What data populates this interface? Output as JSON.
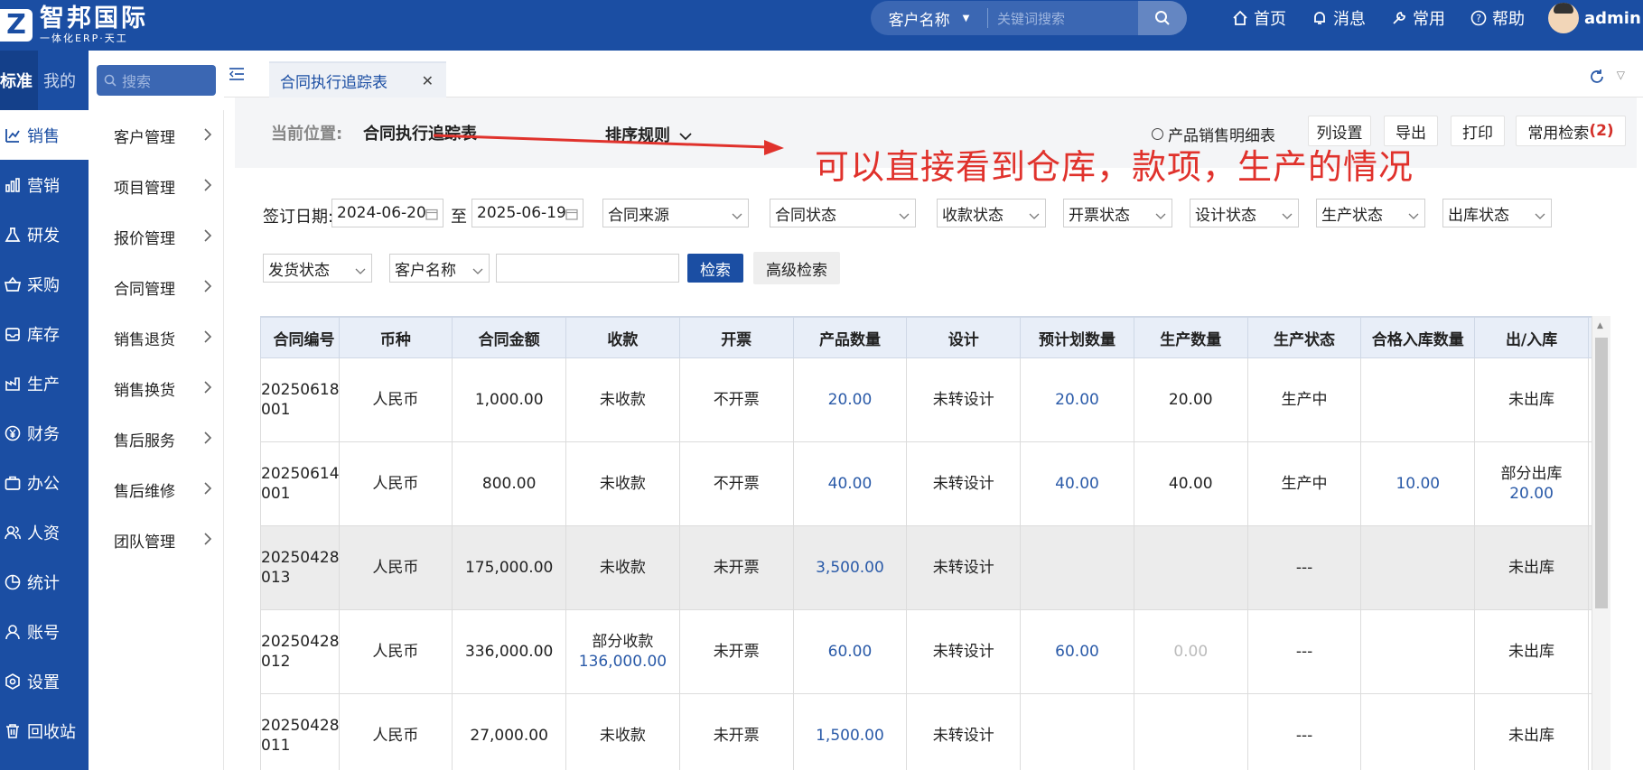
{
  "header": {
    "logo_letter": "Z",
    "brand": "智邦国际",
    "slogan": "一体化ERP·天工",
    "search_type": "客户名称",
    "search_placeholder": "关键词搜索",
    "nav": [
      {
        "label": "首页",
        "icon": "home-icon"
      },
      {
        "label": "消息",
        "icon": "bell-icon"
      },
      {
        "label": "常用",
        "icon": "wrench-icon"
      },
      {
        "label": "帮助",
        "icon": "help-icon"
      }
    ],
    "user": "admin"
  },
  "sidebar": {
    "tabs": [
      "标准",
      "我的"
    ],
    "search_placeholder": "搜索",
    "items": [
      {
        "label": "销售",
        "icon": "chart-icon",
        "active": true
      },
      {
        "label": "营销",
        "icon": "bar-chart-icon"
      },
      {
        "label": "研发",
        "icon": "flask-icon"
      },
      {
        "label": "采购",
        "icon": "basket-icon"
      },
      {
        "label": "库存",
        "icon": "inbox-icon"
      },
      {
        "label": "生产",
        "icon": "factory-icon"
      },
      {
        "label": "财务",
        "icon": "yen-icon"
      },
      {
        "label": "办公",
        "icon": "briefcase-icon"
      },
      {
        "label": "人资",
        "icon": "users-icon"
      },
      {
        "label": "统计",
        "icon": "pie-icon"
      },
      {
        "label": "账号",
        "icon": "user-icon"
      },
      {
        "label": "设置",
        "icon": "gear-icon"
      },
      {
        "label": "回收站",
        "icon": "trash-icon"
      }
    ]
  },
  "submenu": {
    "items": [
      "客户管理",
      "项目管理",
      "报价管理",
      "合同管理",
      "销售退货",
      "销售换货",
      "售后服务",
      "售后维修",
      "团队管理"
    ]
  },
  "tabbar": {
    "active_tab": "合同执行追踪表"
  },
  "crumb": {
    "label": "当前位置:",
    "value": "合同执行追踪表",
    "sort_rule": "排序规则",
    "radio_option": "产品销售明细表",
    "buttons": {
      "columns": "列设置",
      "export": "导出",
      "print": "打印",
      "saved_search": "常用检索",
      "saved_search_count": "(2)"
    }
  },
  "annotation": {
    "text": "可以直接看到仓库，款项，生产的情况",
    "color": "#e0322c"
  },
  "filters": {
    "sign_date_label": "签订日期:",
    "date_from": "2024-06-20",
    "to_label": "至",
    "date_to": "2025-06-19",
    "selects": [
      "合同来源",
      "合同状态",
      "收款状态",
      "开票状态",
      "设计状态",
      "生产状态",
      "出库状态",
      "发货状态",
      "客户名称"
    ],
    "search_button": "检索",
    "advanced_button": "高级检索"
  },
  "table": {
    "columns": [
      "合同编号",
      "币种",
      "合同金额",
      "收款",
      "开票",
      "产品数量",
      "设计",
      "预计划数量",
      "生产数量",
      "生产状态",
      "合格入库数量",
      "出/入库"
    ],
    "rows": [
      {
        "code1": "20250618",
        "code2": "001",
        "currency": "人民币",
        "amount": "1,000.00",
        "receipt": "未收款",
        "receipt2": "",
        "invoice": "不开票",
        "qty": "20.00",
        "design": "未转设计",
        "plan_qty": "20.00",
        "prod_qty": "20.00",
        "prod_status": "生产中",
        "instock_qty": "",
        "io": "未出库",
        "io2": ""
      },
      {
        "code1": "20250614",
        "code2": "001",
        "currency": "人民币",
        "amount": "800.00",
        "receipt": "未收款",
        "receipt2": "",
        "invoice": "不开票",
        "qty": "40.00",
        "design": "未转设计",
        "plan_qty": "40.00",
        "prod_qty": "40.00",
        "prod_status": "生产中",
        "instock_qty": "10.00",
        "io": "部分出库",
        "io2": "20.00"
      },
      {
        "code1": "20250428",
        "code2": "013",
        "currency": "人民币",
        "amount": "175,000.00",
        "receipt": "未收款",
        "receipt2": "",
        "invoice": "未开票",
        "qty": "3,500.00",
        "design": "未转设计",
        "plan_qty": "",
        "prod_qty": "",
        "prod_status": "---",
        "instock_qty": "",
        "io": "未出库",
        "io2": ""
      },
      {
        "code1": "20250428",
        "code2": "012",
        "currency": "人民币",
        "amount": "336,000.00",
        "receipt": "部分收款",
        "receipt2": "136,000.00",
        "invoice": "未开票",
        "qty": "60.00",
        "design": "未转设计",
        "plan_qty": "60.00",
        "prod_qty": "0.00",
        "prod_status": "---",
        "instock_qty": "",
        "io": "未出库",
        "io2": ""
      },
      {
        "code1": "20250428",
        "code2": "011",
        "currency": "人民币",
        "amount": "27,000.00",
        "receipt": "未收款",
        "receipt2": "",
        "invoice": "未开票",
        "qty": "1,500.00",
        "design": "未转设计",
        "plan_qty": "",
        "prod_qty": "",
        "prod_status": "---",
        "instock_qty": "",
        "io": "未出库",
        "io2": ""
      }
    ]
  },
  "colors": {
    "brand_blue": "#1b4ea3",
    "link_blue": "#2a5aa8",
    "accent_red": "#d4312b"
  }
}
